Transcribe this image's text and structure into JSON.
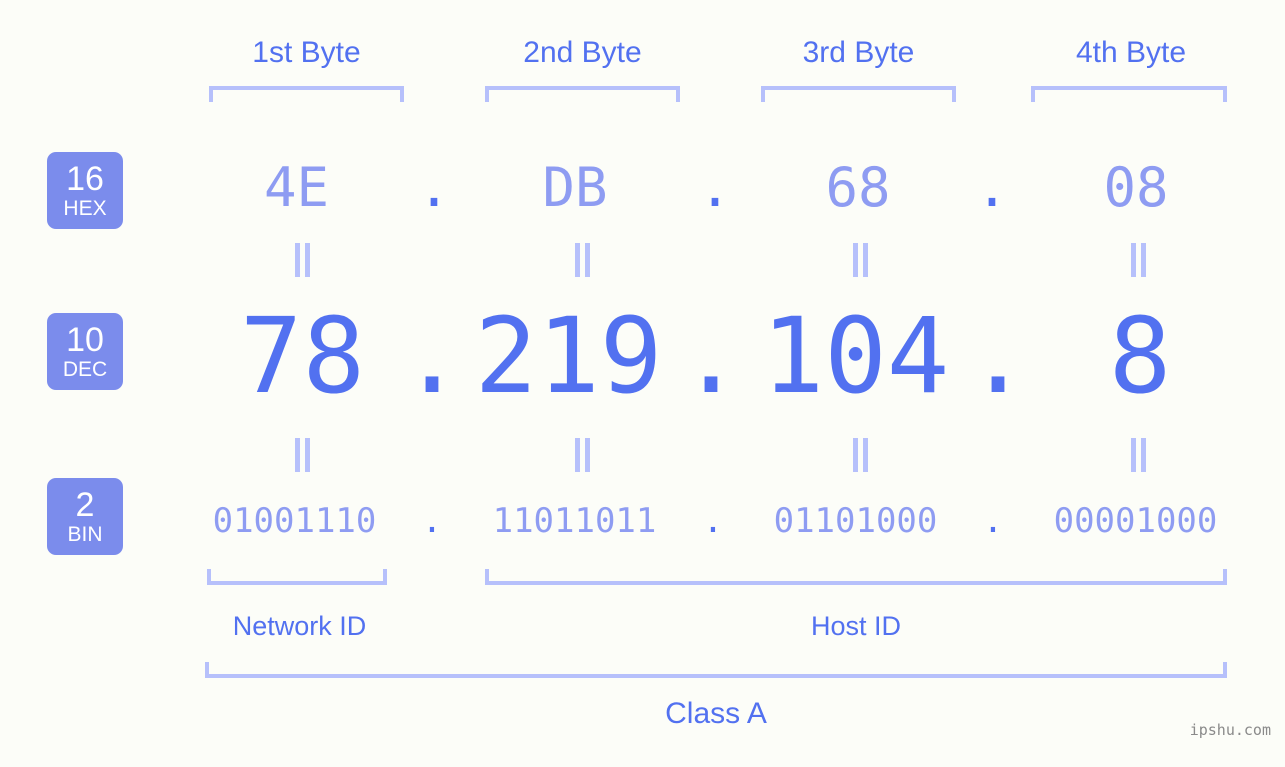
{
  "background": "#fcfdf8",
  "colors": {
    "accent_strong": "#5271f0",
    "accent_light": "#8e9cf2",
    "bracket": "#b6c0fb",
    "badge_bg": "#7b8cec",
    "badge_text": "#ffffff",
    "watermark": "#8a8a8a"
  },
  "byte_headers": [
    {
      "label": "1st Byte"
    },
    {
      "label": "2nd Byte"
    },
    {
      "label": "3rd Byte"
    },
    {
      "label": "4th Byte"
    }
  ],
  "rows": {
    "hex": {
      "badge_number": "16",
      "badge_abbr": "HEX",
      "values": [
        "4E",
        "DB",
        "68",
        "08"
      ],
      "separator": "."
    },
    "dec": {
      "badge_number": "10",
      "badge_abbr": "DEC",
      "values": [
        "78",
        "219",
        "104",
        "8"
      ],
      "separator": "."
    },
    "bin": {
      "badge_number": "2",
      "badge_abbr": "BIN",
      "values": [
        "01001110",
        "11011011",
        "01101000",
        "00001000"
      ],
      "separator": "."
    }
  },
  "equals_glyph": "=",
  "sections": {
    "network_id": "Network ID",
    "host_id": "Host ID",
    "ip_class": "Class A"
  },
  "watermark": "ipshu.com"
}
